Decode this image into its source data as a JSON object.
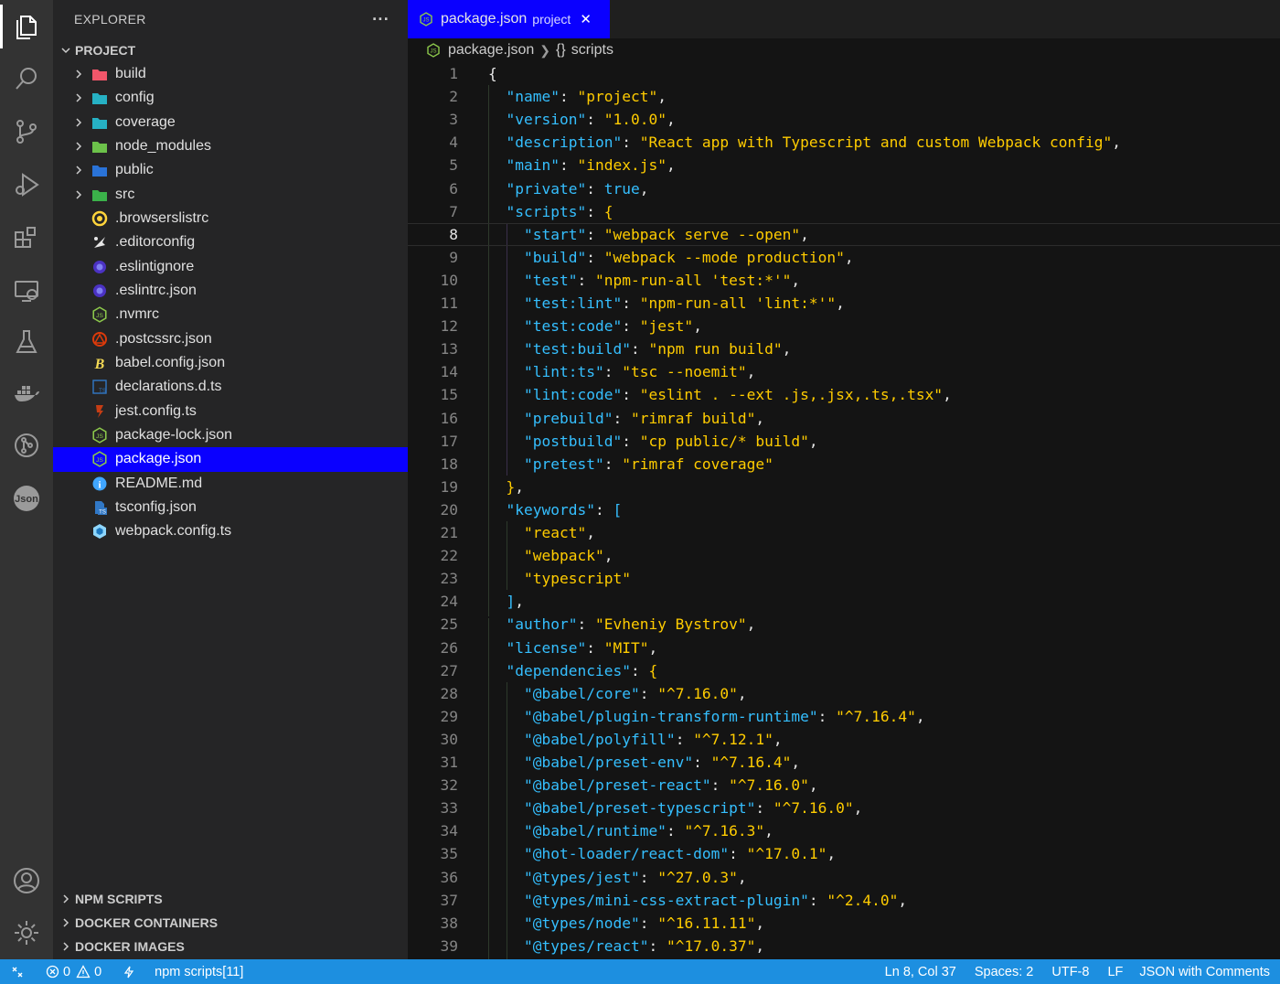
{
  "colors": {
    "accent": "#0a00ff",
    "statusbar": "#1d8fe0",
    "key": "#35bfff",
    "string": "#ffcc00"
  },
  "activity_bar": [
    "files-icon",
    "search-icon",
    "source-control-icon",
    "run-debug-icon",
    "extensions-icon",
    "remote-explorer-icon",
    "testing-icon",
    "docker-icon",
    "gitlens-icon",
    "json-icon",
    "account-icon",
    "settings-gear-icon"
  ],
  "sidebar": {
    "title": "EXPLORER",
    "more": "···",
    "project_label": "PROJECT",
    "folders": [
      {
        "label": "build",
        "color": "#f2566a"
      },
      {
        "label": "config",
        "color": "#26b1c4"
      },
      {
        "label": "coverage",
        "color": "#26b1c4"
      },
      {
        "label": "node_modules",
        "color": "#6cc24a"
      },
      {
        "label": "public",
        "color": "#2a73d8"
      },
      {
        "label": "src",
        "color": "#3bb24a"
      }
    ],
    "files": [
      {
        "label": ".browserslistrc",
        "icon": "browserslist-icon"
      },
      {
        "label": ".editorconfig",
        "icon": "editorconfig-icon"
      },
      {
        "label": ".eslintignore",
        "icon": "eslint-icon"
      },
      {
        "label": ".eslintrc.json",
        "icon": "eslint-icon"
      },
      {
        "label": ".nvmrc",
        "icon": "nodejs-icon"
      },
      {
        "label": ".postcssrc.json",
        "icon": "postcss-icon"
      },
      {
        "label": "babel.config.json",
        "icon": "babel-icon"
      },
      {
        "label": "declarations.d.ts",
        "icon": "typescript-def-icon"
      },
      {
        "label": "jest.config.ts",
        "icon": "jest-icon"
      },
      {
        "label": "package-lock.json",
        "icon": "nodejs-icon"
      },
      {
        "label": "package.json",
        "icon": "nodejs-icon",
        "selected": true
      },
      {
        "label": "README.md",
        "icon": "info-icon"
      },
      {
        "label": "tsconfig.json",
        "icon": "tsconfig-icon"
      },
      {
        "label": "webpack.config.ts",
        "icon": "webpack-icon"
      }
    ],
    "sections": [
      "NPM SCRIPTS",
      "DOCKER CONTAINERS",
      "DOCKER IMAGES"
    ]
  },
  "tab": {
    "label": "package.json",
    "description": "project",
    "close": "✕"
  },
  "breadcrumb": {
    "file": "package.json",
    "symbol_icon": "{}",
    "symbol": "scripts"
  },
  "editor": {
    "current_line": 8,
    "lines": [
      {
        "n": "1",
        "indent": 0,
        "parts": [
          [
            "g",
            "{"
          ]
        ]
      },
      {
        "n": "2",
        "indent": 1,
        "parts": [
          [
            "k",
            "\"name\""
          ],
          [
            "p",
            ": "
          ],
          [
            "s",
            "\"project\""
          ],
          [
            "p",
            ","
          ]
        ]
      },
      {
        "n": "3",
        "indent": 1,
        "parts": [
          [
            "k",
            "\"version\""
          ],
          [
            "p",
            ": "
          ],
          [
            "s",
            "\"1.0.0\""
          ],
          [
            "p",
            ","
          ]
        ]
      },
      {
        "n": "4",
        "indent": 1,
        "parts": [
          [
            "k",
            "\"description\""
          ],
          [
            "p",
            ": "
          ],
          [
            "s",
            "\"React app with Typescript and custom Webpack config\""
          ],
          [
            "p",
            ","
          ]
        ]
      },
      {
        "n": "5",
        "indent": 1,
        "parts": [
          [
            "k",
            "\"main\""
          ],
          [
            "p",
            ": "
          ],
          [
            "s",
            "\"index.js\""
          ],
          [
            "p",
            ","
          ]
        ]
      },
      {
        "n": "6",
        "indent": 1,
        "parts": [
          [
            "k",
            "\"private\""
          ],
          [
            "p",
            ": "
          ],
          [
            "b",
            "true"
          ],
          [
            "p",
            ","
          ]
        ]
      },
      {
        "n": "7",
        "indent": 1,
        "parts": [
          [
            "k",
            "\"scripts\""
          ],
          [
            "p",
            ": "
          ],
          [
            "bo",
            "{"
          ]
        ]
      },
      {
        "n": "8",
        "indent": 2,
        "parts": [
          [
            "k",
            "\"start\""
          ],
          [
            "p",
            ": "
          ],
          [
            "s",
            "\"webpack serve --open\""
          ],
          [
            "p",
            ","
          ]
        ]
      },
      {
        "n": "9",
        "indent": 2,
        "parts": [
          [
            "k",
            "\"build\""
          ],
          [
            "p",
            ": "
          ],
          [
            "s",
            "\"webpack --mode production\""
          ],
          [
            "p",
            ","
          ]
        ]
      },
      {
        "n": "10",
        "indent": 2,
        "parts": [
          [
            "k",
            "\"test\""
          ],
          [
            "p",
            ": "
          ],
          [
            "s",
            "\"npm-run-all 'test:*'\""
          ],
          [
            "p",
            ","
          ]
        ]
      },
      {
        "n": "11",
        "indent": 2,
        "parts": [
          [
            "k",
            "\"test:lint\""
          ],
          [
            "p",
            ": "
          ],
          [
            "s",
            "\"npm-run-all 'lint:*'\""
          ],
          [
            "p",
            ","
          ]
        ]
      },
      {
        "n": "12",
        "indent": 2,
        "parts": [
          [
            "k",
            "\"test:code\""
          ],
          [
            "p",
            ": "
          ],
          [
            "s",
            "\"jest\""
          ],
          [
            "p",
            ","
          ]
        ]
      },
      {
        "n": "13",
        "indent": 2,
        "parts": [
          [
            "k",
            "\"test:build\""
          ],
          [
            "p",
            ": "
          ],
          [
            "s",
            "\"npm run build\""
          ],
          [
            "p",
            ","
          ]
        ]
      },
      {
        "n": "14",
        "indent": 2,
        "parts": [
          [
            "k",
            "\"lint:ts\""
          ],
          [
            "p",
            ": "
          ],
          [
            "s",
            "\"tsc --noemit\""
          ],
          [
            "p",
            ","
          ]
        ]
      },
      {
        "n": "15",
        "indent": 2,
        "parts": [
          [
            "k",
            "\"lint:code\""
          ],
          [
            "p",
            ": "
          ],
          [
            "s",
            "\"eslint . --ext .js,.jsx,.ts,.tsx\""
          ],
          [
            "p",
            ","
          ]
        ]
      },
      {
        "n": "16",
        "indent": 2,
        "parts": [
          [
            "k",
            "\"prebuild\""
          ],
          [
            "p",
            ": "
          ],
          [
            "s",
            "\"rimraf build\""
          ],
          [
            "p",
            ","
          ]
        ]
      },
      {
        "n": "17",
        "indent": 2,
        "parts": [
          [
            "k",
            "\"postbuild\""
          ],
          [
            "p",
            ": "
          ],
          [
            "s",
            "\"cp public/* build\""
          ],
          [
            "p",
            ","
          ]
        ]
      },
      {
        "n": "18",
        "indent": 2,
        "parts": [
          [
            "k",
            "\"pretest\""
          ],
          [
            "p",
            ": "
          ],
          [
            "s",
            "\"rimraf coverage\""
          ]
        ]
      },
      {
        "n": "19",
        "indent": 1,
        "parts": [
          [
            "bo",
            "}"
          ],
          [
            "p",
            ","
          ]
        ]
      },
      {
        "n": "20",
        "indent": 1,
        "parts": [
          [
            "k",
            "\"keywords\""
          ],
          [
            "p",
            ": "
          ],
          [
            "b",
            "["
          ]
        ]
      },
      {
        "n": "21",
        "indent": 2,
        "parts": [
          [
            "s",
            "\"react\""
          ],
          [
            "p",
            ","
          ]
        ]
      },
      {
        "n": "22",
        "indent": 2,
        "parts": [
          [
            "s",
            "\"webpack\""
          ],
          [
            "p",
            ","
          ]
        ]
      },
      {
        "n": "23",
        "indent": 2,
        "parts": [
          [
            "s",
            "\"typescript\""
          ]
        ]
      },
      {
        "n": "24",
        "indent": 1,
        "parts": [
          [
            "b",
            "]"
          ],
          [
            "p",
            ","
          ]
        ]
      },
      {
        "n": "25",
        "indent": 1,
        "parts": [
          [
            "k",
            "\"author\""
          ],
          [
            "p",
            ": "
          ],
          [
            "s",
            "\"Evheniy Bystrov\""
          ],
          [
            "p",
            ","
          ]
        ]
      },
      {
        "n": "26",
        "indent": 1,
        "parts": [
          [
            "k",
            "\"license\""
          ],
          [
            "p",
            ": "
          ],
          [
            "s",
            "\"MIT\""
          ],
          [
            "p",
            ","
          ]
        ]
      },
      {
        "n": "27",
        "indent": 1,
        "parts": [
          [
            "k",
            "\"dependencies\""
          ],
          [
            "p",
            ": "
          ],
          [
            "bo",
            "{"
          ]
        ]
      },
      {
        "n": "28",
        "indent": 2,
        "parts": [
          [
            "k",
            "\"@babel/core\""
          ],
          [
            "p",
            ": "
          ],
          [
            "s",
            "\"^7.16.0\""
          ],
          [
            "p",
            ","
          ]
        ]
      },
      {
        "n": "29",
        "indent": 2,
        "parts": [
          [
            "k",
            "\"@babel/plugin-transform-runtime\""
          ],
          [
            "p",
            ": "
          ],
          [
            "s",
            "\"^7.16.4\""
          ],
          [
            "p",
            ","
          ]
        ]
      },
      {
        "n": "30",
        "indent": 2,
        "parts": [
          [
            "k",
            "\"@babel/polyfill\""
          ],
          [
            "p",
            ": "
          ],
          [
            "s",
            "\"^7.12.1\""
          ],
          [
            "p",
            ","
          ]
        ]
      },
      {
        "n": "31",
        "indent": 2,
        "parts": [
          [
            "k",
            "\"@babel/preset-env\""
          ],
          [
            "p",
            ": "
          ],
          [
            "s",
            "\"^7.16.4\""
          ],
          [
            "p",
            ","
          ]
        ]
      },
      {
        "n": "32",
        "indent": 2,
        "parts": [
          [
            "k",
            "\"@babel/preset-react\""
          ],
          [
            "p",
            ": "
          ],
          [
            "s",
            "\"^7.16.0\""
          ],
          [
            "p",
            ","
          ]
        ]
      },
      {
        "n": "33",
        "indent": 2,
        "parts": [
          [
            "k",
            "\"@babel/preset-typescript\""
          ],
          [
            "p",
            ": "
          ],
          [
            "s",
            "\"^7.16.0\""
          ],
          [
            "p",
            ","
          ]
        ]
      },
      {
        "n": "34",
        "indent": 2,
        "parts": [
          [
            "k",
            "\"@babel/runtime\""
          ],
          [
            "p",
            ": "
          ],
          [
            "s",
            "\"^7.16.3\""
          ],
          [
            "p",
            ","
          ]
        ]
      },
      {
        "n": "35",
        "indent": 2,
        "parts": [
          [
            "k",
            "\"@hot-loader/react-dom\""
          ],
          [
            "p",
            ": "
          ],
          [
            "s",
            "\"^17.0.1\""
          ],
          [
            "p",
            ","
          ]
        ]
      },
      {
        "n": "36",
        "indent": 2,
        "parts": [
          [
            "k",
            "\"@types/jest\""
          ],
          [
            "p",
            ": "
          ],
          [
            "s",
            "\"^27.0.3\""
          ],
          [
            "p",
            ","
          ]
        ]
      },
      {
        "n": "37",
        "indent": 2,
        "parts": [
          [
            "k",
            "\"@types/mini-css-extract-plugin\""
          ],
          [
            "p",
            ": "
          ],
          [
            "s",
            "\"^2.4.0\""
          ],
          [
            "p",
            ","
          ]
        ]
      },
      {
        "n": "38",
        "indent": 2,
        "parts": [
          [
            "k",
            "\"@types/node\""
          ],
          [
            "p",
            ": "
          ],
          [
            "s",
            "\"^16.11.11\""
          ],
          [
            "p",
            ","
          ]
        ]
      },
      {
        "n": "39",
        "indent": 2,
        "parts": [
          [
            "k",
            "\"@types/react\""
          ],
          [
            "p",
            ": "
          ],
          [
            "s",
            "\"^17.0.37\""
          ],
          [
            "p",
            ","
          ]
        ]
      }
    ]
  },
  "statusbar": {
    "remote_icon": "✕",
    "errors": "0",
    "warnings": "0",
    "npm": "npm scripts[11]",
    "cursor": "Ln 8, Col 37",
    "spaces": "Spaces: 2",
    "encoding": "UTF-8",
    "eol": "LF",
    "language": "JSON with Comments"
  }
}
